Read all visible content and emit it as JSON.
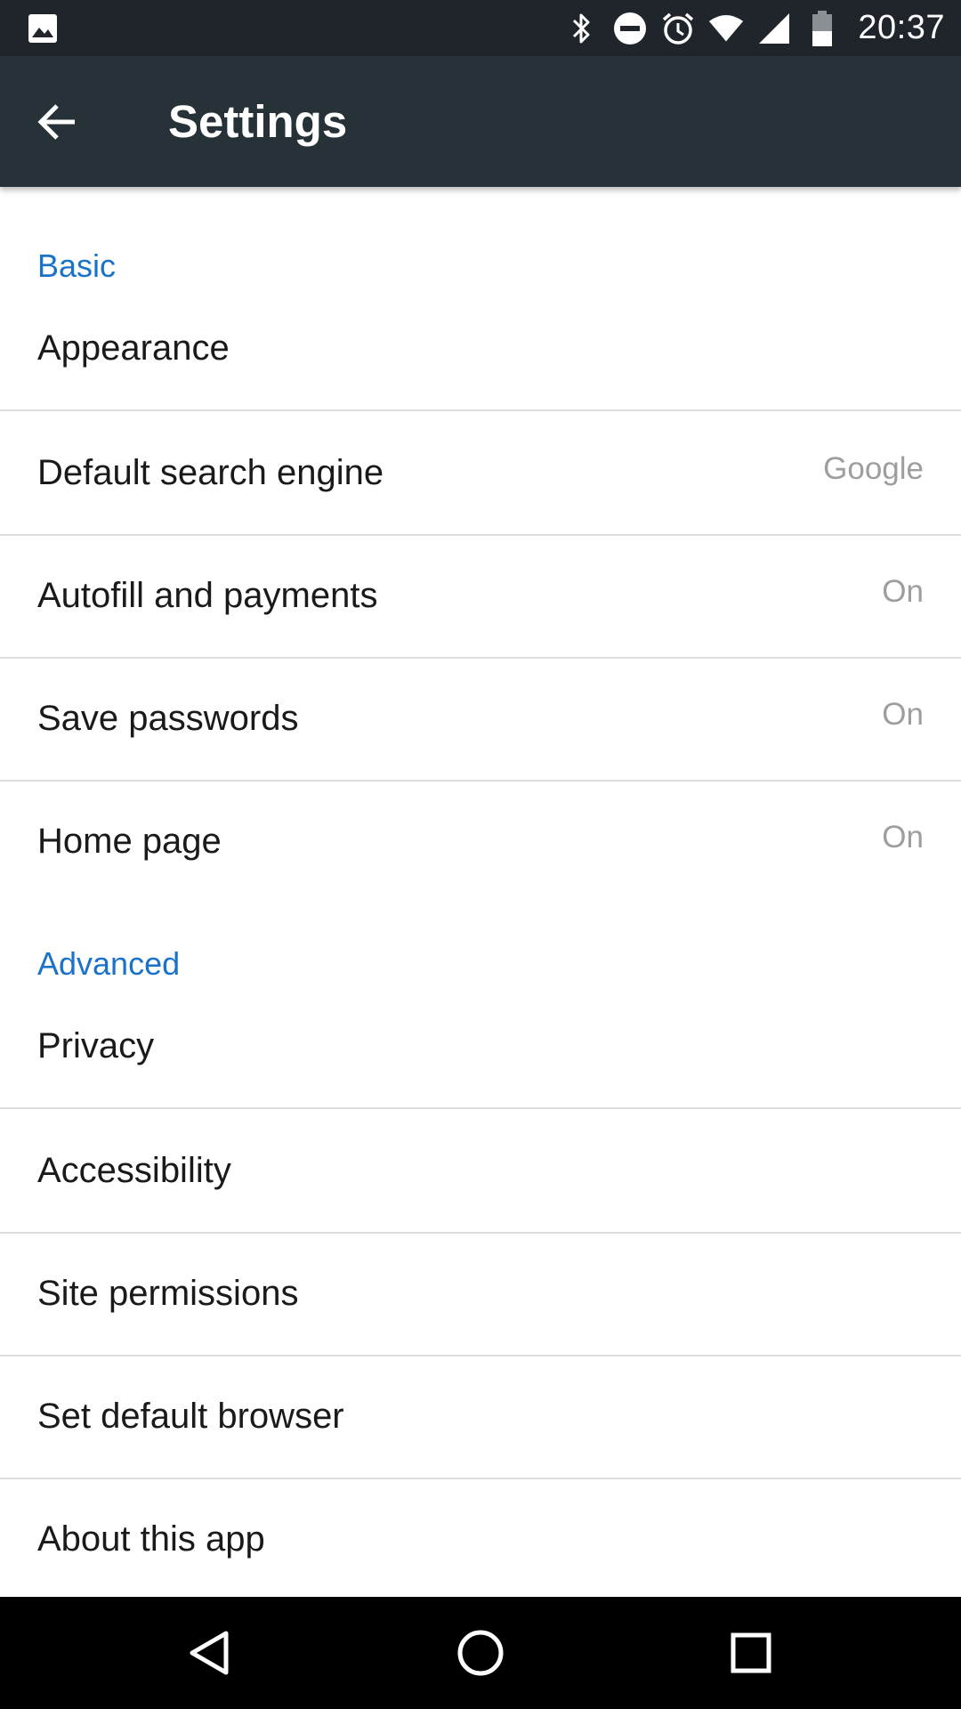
{
  "status_bar": {
    "time": "20:37",
    "left_icon": "image-icon",
    "icons": [
      "bluetooth-icon",
      "do-not-disturb-icon",
      "alarm-icon",
      "wifi-icon",
      "cell-signal-icon",
      "battery-icon"
    ]
  },
  "toolbar": {
    "title": "Settings",
    "back_icon": "back-arrow-icon"
  },
  "sections": {
    "basic": {
      "header": "Basic",
      "items": [
        {
          "label": "Appearance",
          "value": ""
        },
        {
          "label": "Default search engine",
          "value": "Google"
        },
        {
          "label": "Autofill and payments",
          "value": "On"
        },
        {
          "label": "Save passwords",
          "value": "On"
        },
        {
          "label": "Home page",
          "value": "On"
        }
      ]
    },
    "advanced": {
      "header": "Advanced",
      "items": [
        {
          "label": "Privacy",
          "value": ""
        },
        {
          "label": "Accessibility",
          "value": ""
        },
        {
          "label": "Site permissions",
          "value": ""
        },
        {
          "label": "Set default browser",
          "value": ""
        },
        {
          "label": "About this app",
          "value": ""
        }
      ]
    }
  },
  "nav_bar": {
    "icons": [
      "nav-back-icon",
      "nav-home-icon",
      "nav-recents-icon"
    ]
  },
  "colors": {
    "status_bar": "#1f252a",
    "toolbar": "#263238",
    "section_header": "#1a73c8",
    "value_text": "#9e9e9e",
    "divider": "#dcdcdc",
    "nav_bar": "#000000"
  }
}
